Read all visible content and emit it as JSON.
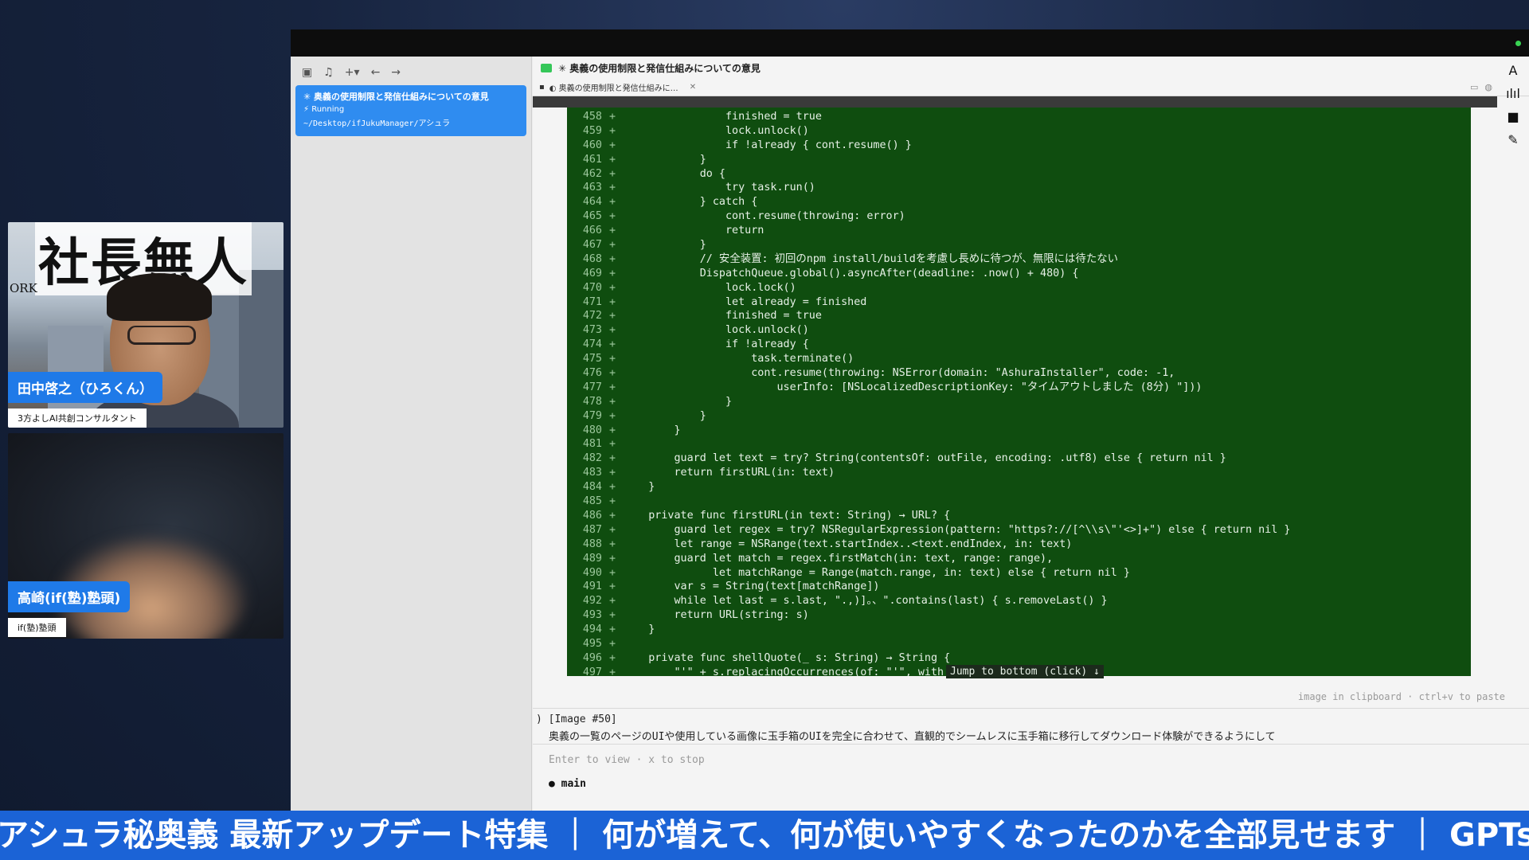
{
  "participants": [
    {
      "name": "田中啓之（ひろくん）",
      "subtitle": "3方よしAI共創コンサルタント",
      "banner": "社長無人",
      "banner_side": "ORK"
    },
    {
      "name": "高崎(if(塾)塾頭)",
      "subtitle": "if(塾)塾頭"
    }
  ],
  "sidebar": {
    "toolbar_icons": [
      "sidebar-toggle-icon",
      "bell-icon",
      "plus-icon",
      "back-arrow-icon",
      "forward-arrow-icon"
    ],
    "session": {
      "title": "✳ 奥義の使用制限と発信仕組みについての意見",
      "status": "Running",
      "path": "~/Desktop/ifJukuManager/アシュラ"
    }
  },
  "main": {
    "header_title": "✳ 奥義の使用制限と発信仕組みについての意見",
    "tab_label": "◐ 奥義の使用制限と発信仕組みに…",
    "tab_close": "✕",
    "right_rail_icons": [
      "font-icon",
      "waveform-icon",
      "stop-icon",
      "pencil-icon"
    ],
    "clipboard_hint": "image in clipboard · ctrl+v to paste",
    "prompt_prefix": ")",
    "prompt_image": "[Image #50]",
    "prompt_text": "奥義の一覧のページのUIや使用している画像に玉手箱のUIを完全に合わせて、直観的でシームレスに玉手箱に移行してダウンロード体験ができるようにして",
    "enter_hint": "Enter to view · x to stop",
    "branch": "● main",
    "jump_button": "Jump to bottom (click) ↓"
  },
  "code": {
    "lines": [
      {
        "n": "458",
        "t": "                finished = true"
      },
      {
        "n": "459",
        "t": "                lock.unlock()"
      },
      {
        "n": "460",
        "t": "                if !already { cont.resume() }"
      },
      {
        "n": "461",
        "t": "            }"
      },
      {
        "n": "462",
        "t": "            do {"
      },
      {
        "n": "463",
        "t": "                try task.run()"
      },
      {
        "n": "464",
        "t": "            } catch {"
      },
      {
        "n": "465",
        "t": "                cont.resume(throwing: error)"
      },
      {
        "n": "466",
        "t": "                return"
      },
      {
        "n": "467",
        "t": "            }"
      },
      {
        "n": "468",
        "t": "            // 安全装置: 初回のnpm install/buildを考慮し長めに待つが、無限には待たない"
      },
      {
        "n": "469",
        "t": "            DispatchQueue.global().asyncAfter(deadline: .now() + 480) {"
      },
      {
        "n": "470",
        "t": "                lock.lock()"
      },
      {
        "n": "471",
        "t": "                let already = finished"
      },
      {
        "n": "472",
        "t": "                finished = true"
      },
      {
        "n": "473",
        "t": "                lock.unlock()"
      },
      {
        "n": "474",
        "t": "                if !already {"
      },
      {
        "n": "475",
        "t": "                    task.terminate()"
      },
      {
        "n": "476",
        "t": "                    cont.resume(throwing: NSError(domain: \"AshuraInstaller\", code: -1,"
      },
      {
        "n": "477",
        "t": "                        userInfo: [NSLocalizedDescriptionKey: \"タイムアウトしました (8分) \"]))"
      },
      {
        "n": "478",
        "t": "                }"
      },
      {
        "n": "479",
        "t": "            }"
      },
      {
        "n": "480",
        "t": "        }"
      },
      {
        "n": "481",
        "t": ""
      },
      {
        "n": "482",
        "t": "        guard let text = try? String(contentsOf: outFile, encoding: .utf8) else { return nil }"
      },
      {
        "n": "483",
        "t": "        return firstURL(in: text)"
      },
      {
        "n": "484",
        "t": "    }"
      },
      {
        "n": "485",
        "t": ""
      },
      {
        "n": "486",
        "t": "    private func firstURL(in text: String) → URL? {"
      },
      {
        "n": "487",
        "t": "        guard let regex = try? NSRegularExpression(pattern: \"https?://[^\\\\s\\\"'<>]+\") else { return nil }"
      },
      {
        "n": "488",
        "t": "        let range = NSRange(text.startIndex..<text.endIndex, in: text)"
      },
      {
        "n": "489",
        "t": "        guard let match = regex.firstMatch(in: text, range: range),"
      },
      {
        "n": "490",
        "t": "              let matchRange = Range(match.range, in: text) else { return nil }"
      },
      {
        "n": "491",
        "t": "        var s = String(text[matchRange])"
      },
      {
        "n": "492",
        "t": "        while let last = s.last, \".,)]。、\".contains(last) { s.removeLast() }"
      },
      {
        "n": "493",
        "t": "        return URL(string: s)"
      },
      {
        "n": "494",
        "t": "    }"
      },
      {
        "n": "495",
        "t": ""
      },
      {
        "n": "496",
        "t": "    private func shellQuote(_ s: String) → String {"
      },
      {
        "n": "497",
        "t": "        \"'\" + s.replacingOccurrences(of: \"'\", with"
      }
    ]
  },
  "ticker": {
    "text": "アシュラ秘奥義 最新アップデート特集 ｜ 何が増えて、何が使いやすくなったのかを全部見せます ｜ GPTs"
  }
}
